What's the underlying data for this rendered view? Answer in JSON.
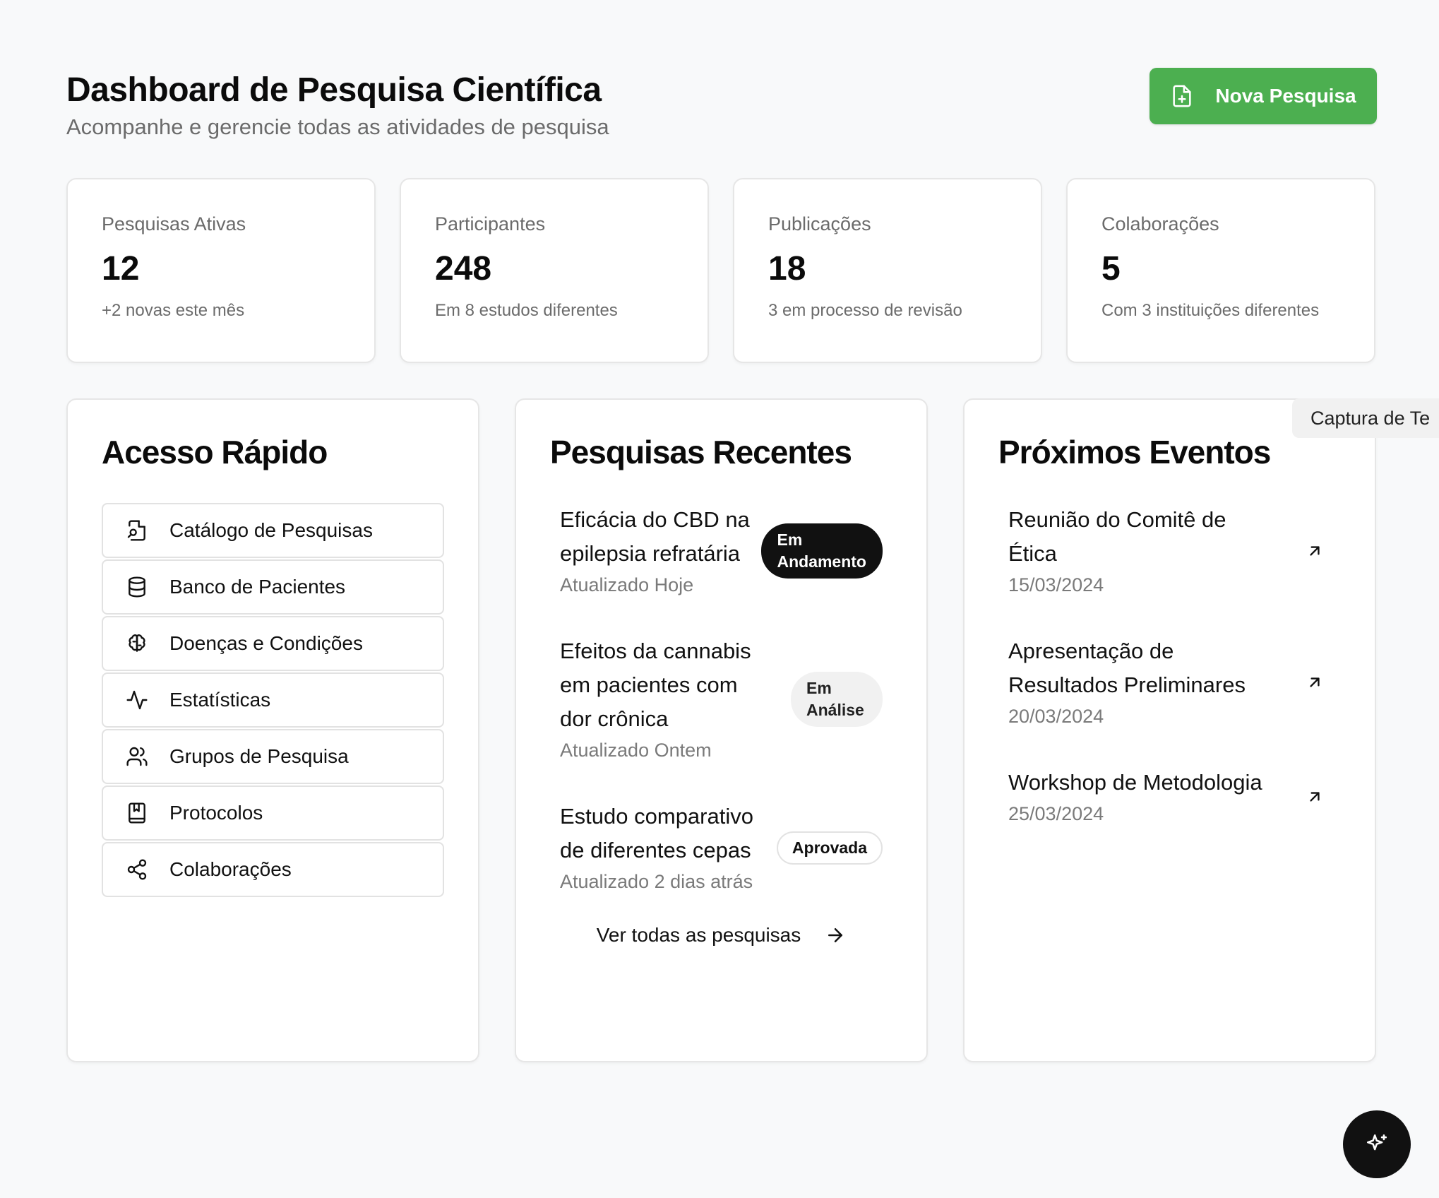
{
  "header": {
    "title": "Dashboard de Pesquisa Científica",
    "subtitle": "Acompanhe e gerencie todas as atividades de pesquisa",
    "new_button": "Nova Pesquisa"
  },
  "stats": [
    {
      "label": "Pesquisas Ativas",
      "value": "12",
      "note": "+2 novas este mês"
    },
    {
      "label": "Participantes",
      "value": "248",
      "note": "Em 8 estudos diferentes"
    },
    {
      "label": "Publicações",
      "value": "18",
      "note": "3 em processo de revisão"
    },
    {
      "label": "Colaborações",
      "value": "5",
      "note": "Com 3 instituições diferentes"
    }
  ],
  "quick_access": {
    "title": "Acesso Rápido",
    "items": [
      {
        "label": "Catálogo de Pesquisas",
        "icon": "file-search-icon"
      },
      {
        "label": "Banco de Pacientes",
        "icon": "database-icon"
      },
      {
        "label": "Doenças e Condições",
        "icon": "brain-icon"
      },
      {
        "label": "Estatísticas",
        "icon": "activity-icon"
      },
      {
        "label": "Grupos de Pesquisa",
        "icon": "users-icon"
      },
      {
        "label": "Protocolos",
        "icon": "book-icon"
      },
      {
        "label": "Colaborações",
        "icon": "share-icon"
      }
    ]
  },
  "recent_research": {
    "title": "Pesquisas Recentes",
    "items": [
      {
        "title": "Eficácia do CBD na epilepsia refratária",
        "updated": "Atualizado Hoje",
        "status": "Em Andamento"
      },
      {
        "title": "Efeitos da cannabis em pacientes com dor crônica",
        "updated": "Atualizado Ontem",
        "status": "Em Análise"
      },
      {
        "title": "Estudo comparativo de diferentes cepas",
        "updated": "Atualizado 2 dias atrás",
        "status": "Aprovada"
      }
    ],
    "view_all": "Ver todas as pesquisas"
  },
  "events": {
    "title": "Próximos Eventos",
    "items": [
      {
        "title": "Reunião do Comitê de Ética",
        "date": "15/03/2024"
      },
      {
        "title": "Apresentação de Resultados Preliminares",
        "date": "20/03/2024"
      },
      {
        "title": "Workshop de Metodologia",
        "date": "25/03/2024"
      }
    ]
  },
  "tooltip": "Captura de Te",
  "colors": {
    "accent": "#4caf50",
    "dark_badge": "#111111"
  }
}
